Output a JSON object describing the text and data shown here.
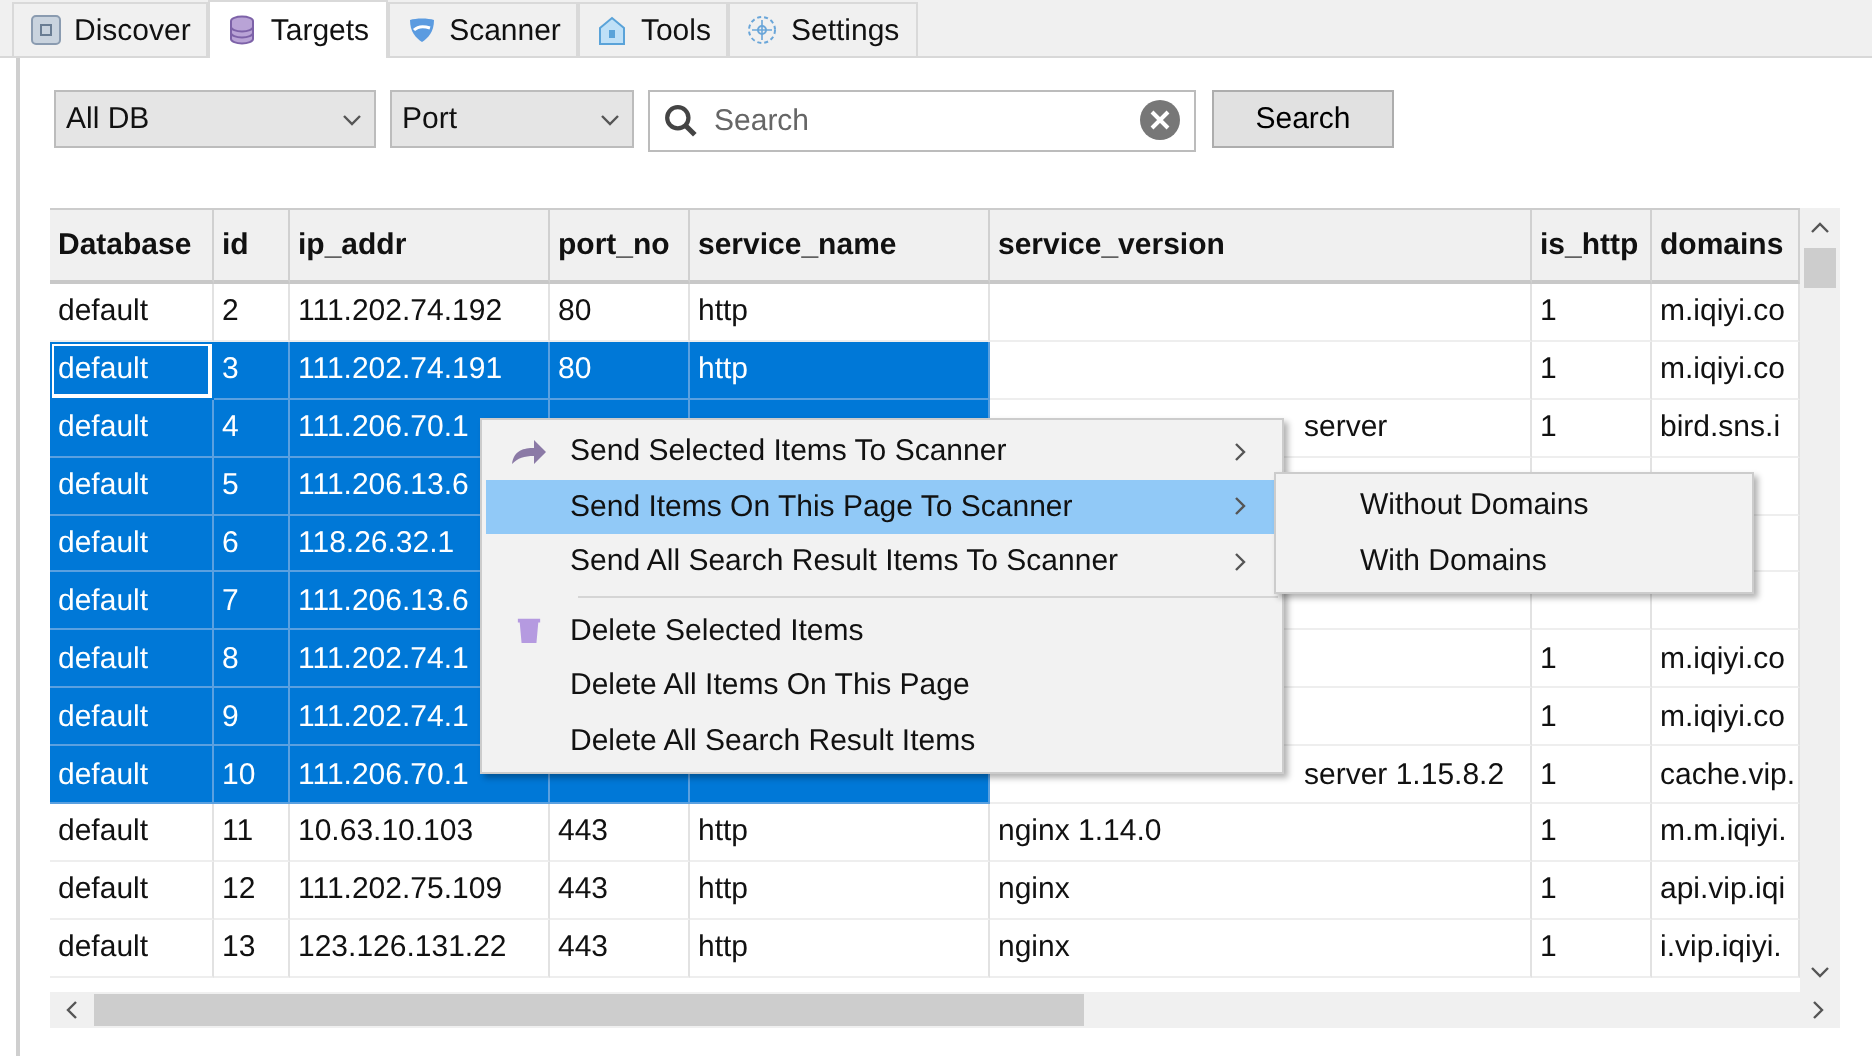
{
  "tabs": [
    {
      "label": "Discover",
      "selected": false
    },
    {
      "label": "Targets",
      "selected": true
    },
    {
      "label": "Scanner",
      "selected": false
    },
    {
      "label": "Tools",
      "selected": false
    },
    {
      "label": "Settings",
      "selected": false
    }
  ],
  "filters": [
    {
      "value": "All DB"
    },
    {
      "value": "Port"
    }
  ],
  "search": {
    "placeholder": "Search",
    "button": "Search"
  },
  "table": {
    "columns": [
      "Database",
      "id",
      "ip_addr",
      "port_no",
      "service_name",
      "service_version",
      "is_http",
      "domains"
    ],
    "rows": [
      {
        "selected": false,
        "focused": false,
        "cells": [
          "default",
          "2",
          "111.202.74.192",
          "80",
          "http",
          "",
          "1",
          "m.iqiyi.co"
        ]
      },
      {
        "selected": true,
        "focused": true,
        "cells": [
          "default",
          "3",
          "111.202.74.191",
          "80",
          "http",
          "",
          "1",
          "m.iqiyi.co"
        ]
      },
      {
        "selected": true,
        "focused": false,
        "cells": [
          "default",
          "4",
          "111.206.70.1",
          "",
          "",
          "server",
          "1",
          "bird.sns.i"
        ]
      },
      {
        "selected": true,
        "focused": false,
        "cells": [
          "default",
          "5",
          "111.206.13.6",
          null,
          null,
          "",
          "",
          ""
        ]
      },
      {
        "selected": true,
        "focused": false,
        "cells": [
          "default",
          "6",
          "118.26.32.1",
          null,
          null,
          null,
          null,
          ""
        ]
      },
      {
        "selected": true,
        "focused": false,
        "cells": [
          "default",
          "7",
          "111.206.13.6",
          null,
          null,
          "",
          "",
          ""
        ]
      },
      {
        "selected": true,
        "focused": false,
        "cells": [
          "default",
          "8",
          "111.202.74.1",
          null,
          null,
          "",
          "1",
          "m.iqiyi.co"
        ]
      },
      {
        "selected": true,
        "focused": false,
        "cells": [
          "default",
          "9",
          "111.202.74.1",
          null,
          null,
          "",
          "1",
          "m.iqiyi.co"
        ]
      },
      {
        "selected": true,
        "focused": false,
        "cells": [
          "default",
          "10",
          "111.206.70.1",
          "",
          "",
          "server 1.15.8.2",
          "1",
          "cache.vip."
        ]
      },
      {
        "selected": false,
        "focused": false,
        "cells": [
          "default",
          "11",
          "10.63.10.103",
          "443",
          "http",
          "nginx 1.14.0",
          "1",
          "m.m.iqiyi."
        ]
      },
      {
        "selected": false,
        "focused": false,
        "cells": [
          "default",
          "12",
          "111.202.75.109",
          "443",
          "http",
          "nginx",
          "1",
          "api.vip.iqi"
        ]
      },
      {
        "selected": false,
        "focused": false,
        "cells": [
          "default",
          "13",
          "123.126.131.22",
          "443",
          "http",
          "nginx",
          "1",
          "i.vip.iqiyi."
        ]
      }
    ]
  },
  "context_menu": {
    "sections": [
      [
        {
          "label": "Send Selected Items To Scanner",
          "selected": false,
          "submenu": true
        },
        {
          "label": "Send Items On This Page To Scanner",
          "selected": true,
          "submenu": true
        },
        {
          "label": "Send All Search Result Items To Scanner",
          "selected": false,
          "submenu": true
        }
      ],
      [
        {
          "label": "Delete Selected Items",
          "selected": false,
          "submenu": false
        },
        {
          "label": "Delete All Items On This Page",
          "selected": false,
          "submenu": false
        },
        {
          "label": "Delete All Search Result Items",
          "selected": false,
          "submenu": false
        }
      ]
    ],
    "submenu": [
      "Without Domains",
      "With Domains"
    ]
  }
}
